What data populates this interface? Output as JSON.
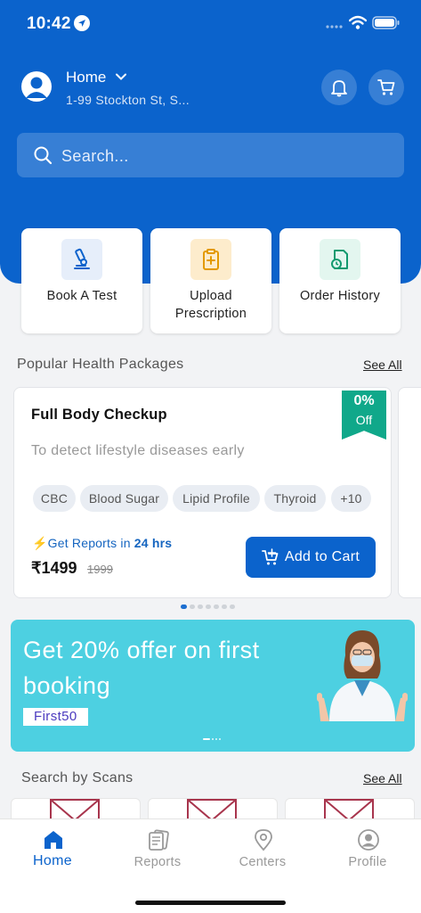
{
  "status": {
    "time": "10:42"
  },
  "header": {
    "location_title": "Home",
    "location_address": "1-99 Stockton St, S...",
    "search_placeholder": "Search..."
  },
  "quick_actions": [
    {
      "label": "Book A Test",
      "icon": "microscope-icon"
    },
    {
      "label": "Upload\nPrescription",
      "icon": "prescription-icon"
    },
    {
      "label": "Order History",
      "icon": "order-history-icon"
    }
  ],
  "packages_section": {
    "title": "Popular Health Packages",
    "see_all": "See All",
    "package": {
      "title": "Full Body Checkup",
      "discount_pct": "0%",
      "discount_off": "Off",
      "description": "To detect lifestyle diseases early",
      "chips": [
        "CBC",
        "Blood Sugar",
        "Lipid Profile",
        "Thyroid",
        "+10"
      ],
      "reports_prefix": "Get Reports in ",
      "reports_time": "24 hrs",
      "price": "₹1499",
      "old_price": "1999",
      "add_to_cart": "Add to Cart"
    },
    "carousel_total": 7,
    "carousel_active": 1
  },
  "banner": {
    "text": "Get 20% offer on first booking",
    "promo_code": "First50"
  },
  "scans_section": {
    "title": "Search by Scans",
    "see_all": "See All"
  },
  "tabs": [
    {
      "label": "Home",
      "icon": "home-icon",
      "active": true
    },
    {
      "label": "Reports",
      "icon": "reports-icon",
      "active": false
    },
    {
      "label": "Centers",
      "icon": "location-pin-icon",
      "active": false
    },
    {
      "label": "Profile",
      "icon": "profile-icon",
      "active": false
    }
  ],
  "colors": {
    "primary": "#0b63cc",
    "banner": "#4dd0e1",
    "ribbon": "#10a88a",
    "accent_bolt": "#f5b800"
  }
}
